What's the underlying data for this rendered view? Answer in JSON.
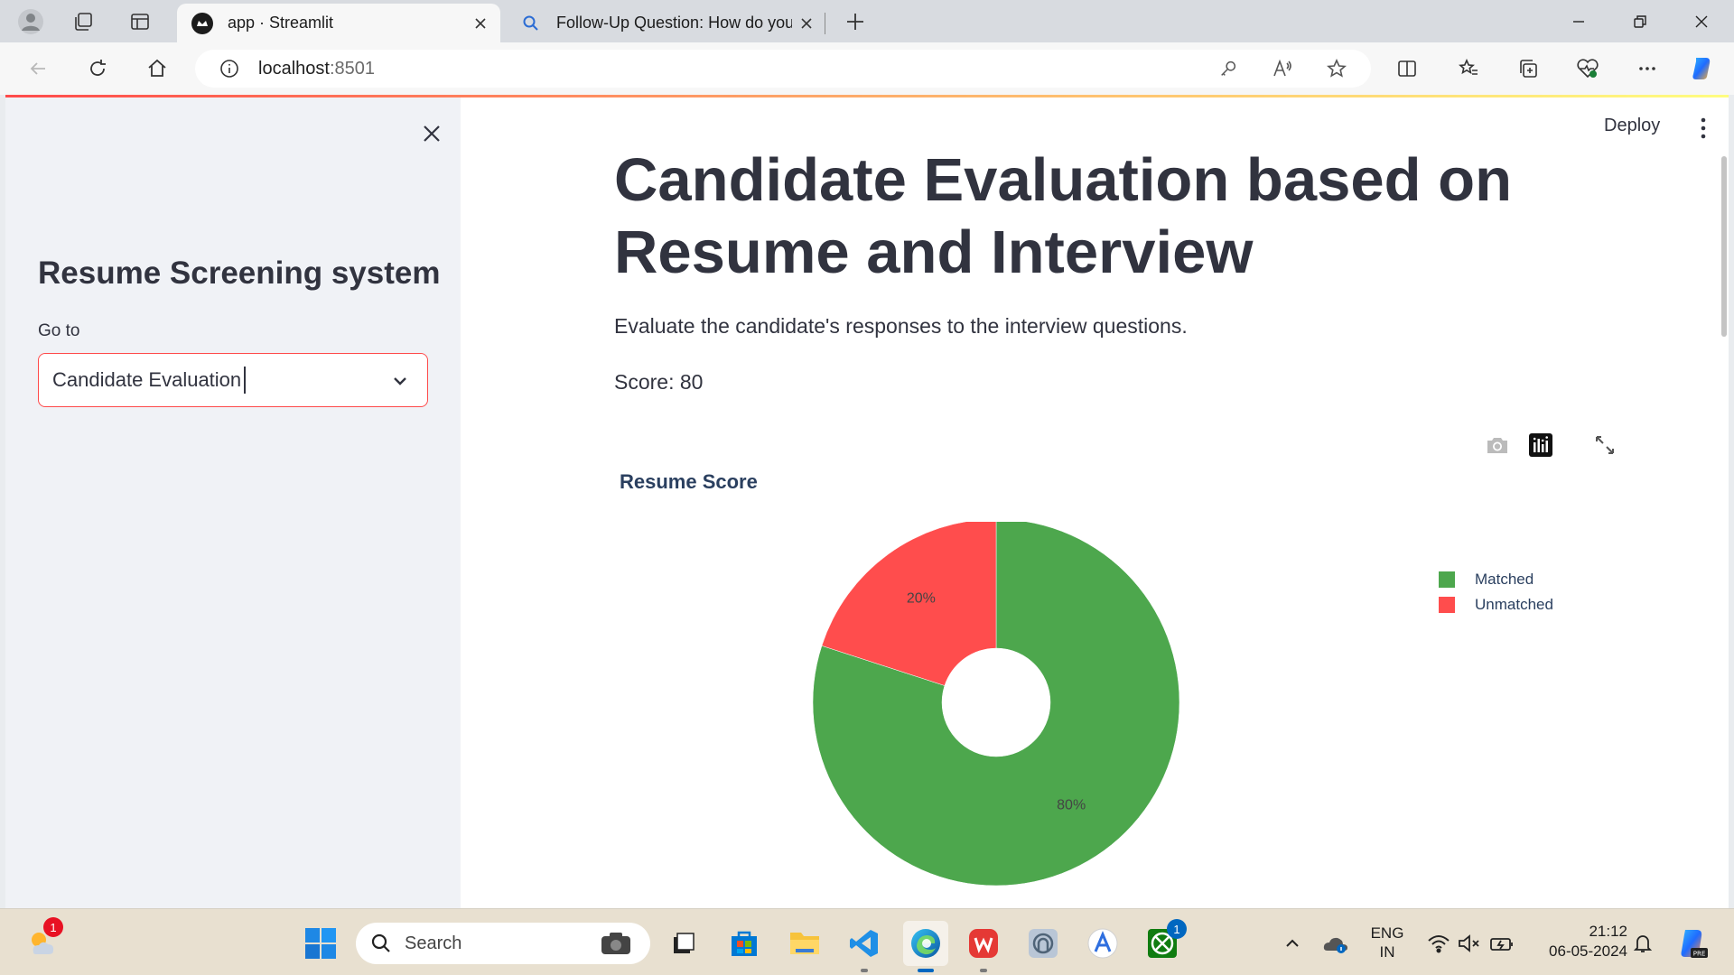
{
  "browser": {
    "tabs": [
      {
        "title": "app · Streamlit",
        "active": true
      },
      {
        "title": "Follow-Up Question: How do you",
        "active": false
      }
    ],
    "url_host": "localhost",
    "url_port": ":8501"
  },
  "app": {
    "deploy_label": "Deploy",
    "sidebar": {
      "title": "Resume Screening system",
      "nav_label": "Go to",
      "selected_page": "Candidate Evaluation"
    },
    "main": {
      "title": "Candidate Evaluation based on Resume and Interview",
      "description": "Evaluate the candidate's responses to the interview questions.",
      "score_text": "Score: 80"
    }
  },
  "chart_data": {
    "type": "pie",
    "title": "Resume Score",
    "hole": true,
    "labels": [
      "Matched",
      "Unmatched"
    ],
    "values": [
      80,
      20
    ],
    "colors": [
      "#4da74d",
      "#ff4d4d"
    ],
    "text_labels": [
      "80%",
      "20%"
    ],
    "legend_position": "top-right"
  },
  "taskbar": {
    "search_placeholder": "Search",
    "weather_badge": "1",
    "xbox_badge": "1",
    "lang_line1": "ENG",
    "lang_line2": "IN",
    "time": "21:12",
    "date": "06-05-2024"
  }
}
